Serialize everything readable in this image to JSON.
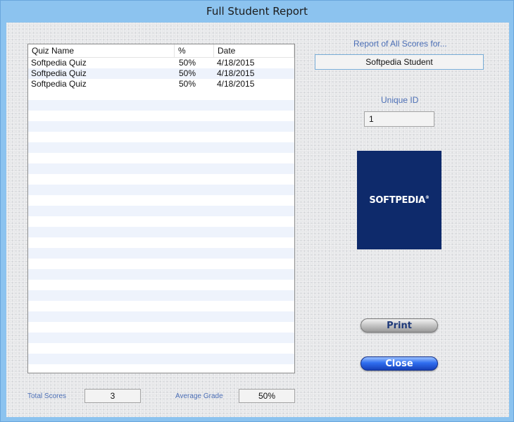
{
  "window": {
    "title": "Full Student Report"
  },
  "list": {
    "columns": [
      "Quiz Name",
      "%",
      "Date"
    ],
    "rows": [
      {
        "name": "Softpedia Quiz",
        "percent": "50%",
        "date": "4/18/2015"
      },
      {
        "name": "Softpedia Quiz",
        "percent": "50%",
        "date": "4/18/2015"
      },
      {
        "name": "Softpedia Quiz",
        "percent": "50%",
        "date": "4/18/2015"
      }
    ]
  },
  "report": {
    "heading": "Report of All Scores for...",
    "student_name": "Softpedia Student",
    "unique_id_label": "Unique ID",
    "unique_id": "1"
  },
  "logo": {
    "text": "SOFTPEDIA",
    "mark": "®"
  },
  "buttons": {
    "print": "Print",
    "close": "Close"
  },
  "footer": {
    "total_scores_label": "Total Scores",
    "total_scores": "3",
    "average_grade_label": "Average Grade",
    "average_grade": "50%"
  },
  "colors": {
    "accent_label": "#4c6fb6",
    "logo_bg": "#0e2a6b",
    "row_stripe": "#eef3fc"
  }
}
